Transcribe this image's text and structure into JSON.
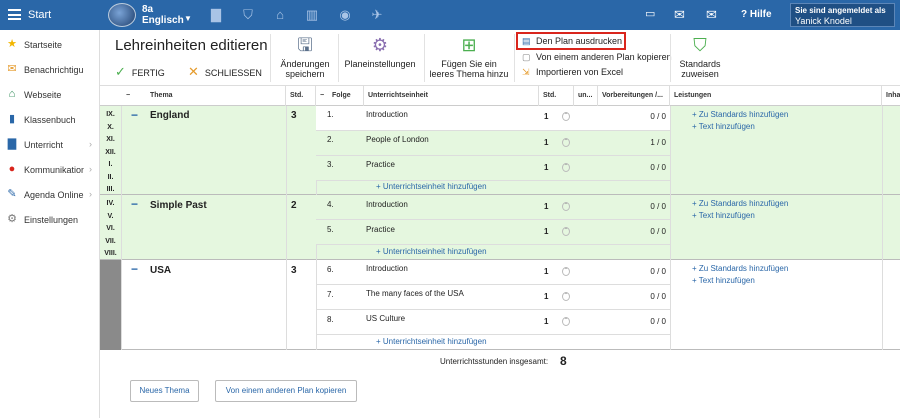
{
  "topbar": {
    "start_label": "Start",
    "class_name": "8a",
    "class_subject": "Englisch",
    "class_dropdown": "▼",
    "nav_icons": [
      "briefcase-icon",
      "shield-icon",
      "institution-icon",
      "chart-icon",
      "globe-icon",
      "walker-icon"
    ],
    "help_label": "Hilfe",
    "user_label": "Sie sind angemeldet als",
    "user_name": "Yanick Knodel"
  },
  "sidebar": {
    "items": [
      {
        "label": "Startseite",
        "icon": "star-icon",
        "color": "#f2b600",
        "chev": ""
      },
      {
        "label": "Benachrichtigu...",
        "icon": "envelope-icon",
        "color": "#e59b2c",
        "chev": ""
      },
      {
        "label": "Webseite",
        "icon": "home-icon",
        "color": "#2e8b57",
        "chev": ""
      },
      {
        "label": "Klassenbuch",
        "icon": "book-icon",
        "color": "#2a67a8",
        "chev": ""
      },
      {
        "label": "Unterricht",
        "icon": "briefcase-icon",
        "color": "#2a67a8",
        "chev": "›"
      },
      {
        "label": "Kommunikation",
        "icon": "chat-icon",
        "color": "#d9251c",
        "chev": "›"
      },
      {
        "label": "Agenda Online",
        "icon": "pen-icon",
        "color": "#2a67a8",
        "chev": "›"
      },
      {
        "label": "Einstellungen",
        "icon": "gear-icon",
        "color": "#777777",
        "chev": ""
      }
    ]
  },
  "toolbar": {
    "title": "Lehreinheiten editieren",
    "done_label": "FERTIG",
    "close_label": "SCHLIESSEN",
    "save_label_1": "Änderungen",
    "save_label_2": "speichern",
    "settings_label": "Planeinstellungen",
    "add_topic_1": "Fügen Sie ein",
    "add_topic_2": "leeres Thema hinzu",
    "print_label": "Den Plan ausdrucken",
    "copy_label": "Von einem anderen Plan kopieren",
    "import_label": "Importieren von Excel",
    "standards_1": "Standards",
    "standards_2": "zuweisen"
  },
  "table": {
    "headers": [
      "Thema",
      "Std.",
      "Folge",
      "Unterrichtseinheit",
      "Std.",
      "un...",
      "Vorbereitungen /...",
      "Leistungen",
      "Inha"
    ],
    "add_unit_label": "+ Unterrichtseinheit hinzufügen",
    "add_standard_label": "+ Zu Standards hinzufügen",
    "add_text_label": "+ Text hinzufügen",
    "topics": [
      {
        "name": "England",
        "hours": "3",
        "months": [
          "IX.",
          "X.",
          "XI.",
          "XII.",
          "I.",
          "II.",
          "III."
        ],
        "units": [
          {
            "num": "1.",
            "title": "Introduction",
            "hours": "1",
            "prep": "0 / 0"
          },
          {
            "num": "2.",
            "title": "People of London",
            "hours": "1",
            "prep": "1 / 0"
          },
          {
            "num": "3.",
            "title": "Practice",
            "hours": "1",
            "prep": "0 / 0"
          }
        ]
      },
      {
        "name": "Simple Past",
        "hours": "2",
        "months": [
          "IV.",
          "V.",
          "VI.",
          "VII.",
          "VIII."
        ],
        "units": [
          {
            "num": "4.",
            "title": "Introduction",
            "hours": "1",
            "prep": "0 / 0"
          },
          {
            "num": "5.",
            "title": "Practice",
            "hours": "1",
            "prep": "0 / 0"
          }
        ]
      },
      {
        "name": "USA",
        "hours": "3",
        "months": [],
        "units": [
          {
            "num": "6.",
            "title": "Introduction",
            "hours": "1",
            "prep": "0 / 0"
          },
          {
            "num": "7.",
            "title": "The many faces of the USA",
            "hours": "1",
            "prep": "0 / 0"
          },
          {
            "num": "8.",
            "title": "US Culture",
            "hours": "1",
            "prep": "0 / 0"
          }
        ]
      }
    ],
    "total_label": "Unterrichtsstunden insgesamt:",
    "total_value": "8"
  },
  "footer": {
    "new_topic": "Neues Thema",
    "copy_plan": "Von einem anderen Plan kopieren"
  },
  "colors": {
    "accent": "#2a67a8",
    "topic_green": "#e5f7df",
    "highlight": "#d9251c"
  }
}
